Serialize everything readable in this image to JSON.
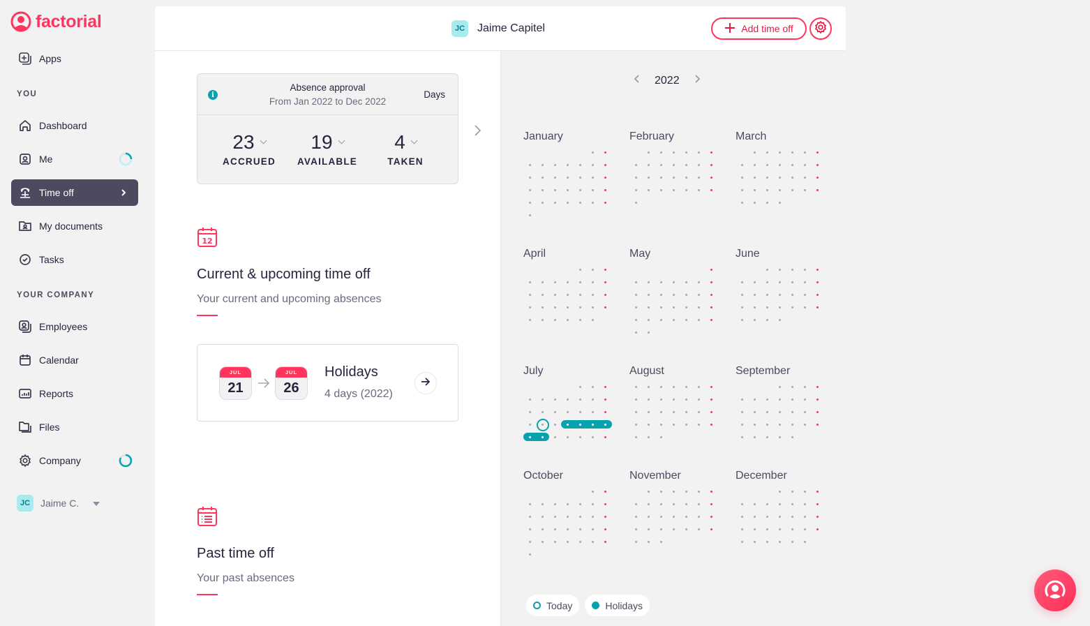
{
  "brand": {
    "name": "factorial",
    "color": "#ff355e"
  },
  "sidebar": {
    "apps_label": "Apps",
    "you_section": "YOU",
    "company_section": "YOUR COMPANY",
    "items": [
      {
        "label": "Dashboard",
        "icon": "home-icon"
      },
      {
        "label": "Me",
        "icon": "user-badge-icon"
      },
      {
        "label": "Time off",
        "icon": "palm-tree-icon",
        "active": true
      },
      {
        "label": "My documents",
        "icon": "folder-user-icon"
      },
      {
        "label": "Tasks",
        "icon": "check-circle-icon"
      },
      {
        "label": "Employees",
        "icon": "employees-icon"
      },
      {
        "label": "Calendar",
        "icon": "calendar-icon"
      },
      {
        "label": "Reports",
        "icon": "chart-icon"
      },
      {
        "label": "Files",
        "icon": "files-icon"
      },
      {
        "label": "Company",
        "icon": "gear-icon"
      }
    ],
    "user": {
      "initials": "JC",
      "name": "Jaime C."
    }
  },
  "header": {
    "employee_initials": "JC",
    "employee_name": "Jaime Capitel",
    "add_button": "Add time off"
  },
  "balance": {
    "title": "Absence approval",
    "period": "From Jan 2022 to Dec 2022",
    "unit": "Days",
    "stats": [
      {
        "value": "23",
        "label": "ACCRUED"
      },
      {
        "value": "19",
        "label": "AVAILABLE"
      },
      {
        "value": "4",
        "label": "TAKEN"
      }
    ]
  },
  "upcoming": {
    "title": "Current & upcoming time off",
    "subtitle": "Your current and upcoming absences",
    "items": [
      {
        "start_month": "JUL",
        "start_day": "21",
        "end_month": "JUL",
        "end_day": "26",
        "type": "Holidays",
        "summary": "4 days (2022)"
      }
    ]
  },
  "past": {
    "title": "Past time off",
    "subtitle": "Your past absences"
  },
  "calendar": {
    "year": "2022",
    "week_start": "Monday",
    "months": [
      "January",
      "February",
      "March",
      "April",
      "May",
      "June",
      "July",
      "August",
      "September",
      "October",
      "November",
      "December"
    ],
    "today": {
      "month": 7,
      "day": 19
    },
    "holidays": [
      {
        "month": 7,
        "from": 21,
        "to": 26
      }
    ],
    "colors": {
      "holiday": "#07a2ad",
      "sunday": "#ff355e",
      "weekday": "#a7a7b5"
    },
    "legend": [
      "Today",
      "Holidays"
    ]
  }
}
